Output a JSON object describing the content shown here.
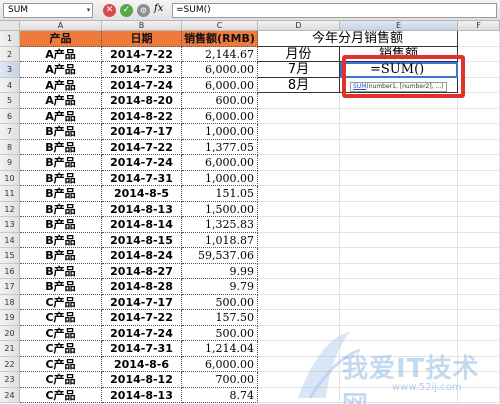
{
  "formula_bar": {
    "name_box": "SUM",
    "cancel_icon": "x-icon",
    "enter_icon": "check-icon",
    "function_icon": "function-icon",
    "fx_label": "fx",
    "formula": "=SUM()"
  },
  "columns": [
    "A",
    "B",
    "C",
    "D",
    "E",
    "F"
  ],
  "rows": [
    "1",
    "2",
    "3",
    "4",
    "5",
    "6",
    "7",
    "8",
    "9",
    "10",
    "11",
    "12",
    "13",
    "14",
    "15",
    "16",
    "17",
    "18",
    "19",
    "20",
    "21",
    "22",
    "23",
    "24"
  ],
  "table": {
    "headers": [
      "产品",
      "日期",
      "销售额(RMB)"
    ],
    "rows": [
      [
        "A产品",
        "2014-7-22",
        "2,144.67"
      ],
      [
        "A产品",
        "2014-7-23",
        "6,000.00"
      ],
      [
        "A产品",
        "2014-7-24",
        "6,000.00"
      ],
      [
        "A产品",
        "2014-8-20",
        "600.00"
      ],
      [
        "A产品",
        "2014-8-22",
        "6,000.00"
      ],
      [
        "B产品",
        "2014-7-17",
        "1,000.00"
      ],
      [
        "B产品",
        "2014-7-22",
        "1,377.05"
      ],
      [
        "B产品",
        "2014-7-24",
        "6,000.00"
      ],
      [
        "B产品",
        "2014-7-31",
        "1,000.00"
      ],
      [
        "B产品",
        "2014-8-5",
        "151.05"
      ],
      [
        "B产品",
        "2014-8-13",
        "1,500.00"
      ],
      [
        "B产品",
        "2014-8-14",
        "1,325.83"
      ],
      [
        "B产品",
        "2014-8-15",
        "1,018.87"
      ],
      [
        "B产品",
        "2014-8-24",
        "59,537.06"
      ],
      [
        "B产品",
        "2014-8-27",
        "9.99"
      ],
      [
        "B产品",
        "2014-8-28",
        "9.79"
      ],
      [
        "C产品",
        "2014-7-17",
        "500.00"
      ],
      [
        "C产品",
        "2014-7-22",
        "157.50"
      ],
      [
        "C产品",
        "2014-7-24",
        "500.00"
      ],
      [
        "C产品",
        "2014-7-31",
        "1,214.04"
      ],
      [
        "C产品",
        "2014-8-6",
        "6,000.00"
      ],
      [
        "C产品",
        "2014-8-12",
        "700.00"
      ],
      [
        "C产品",
        "2014-8-13",
        "8.74"
      ]
    ]
  },
  "summary": {
    "title": "今年分月销售额",
    "month_header": "月份",
    "sales_header": "销售额",
    "months": [
      "7月",
      "8月"
    ],
    "active_cell_value": "=SUM()",
    "tooltip_fn": "SUM",
    "tooltip_args": "(number1, [number2], ...)"
  },
  "watermark": {
    "text": "我爱IT技术网",
    "url": "www.52ij.com"
  }
}
